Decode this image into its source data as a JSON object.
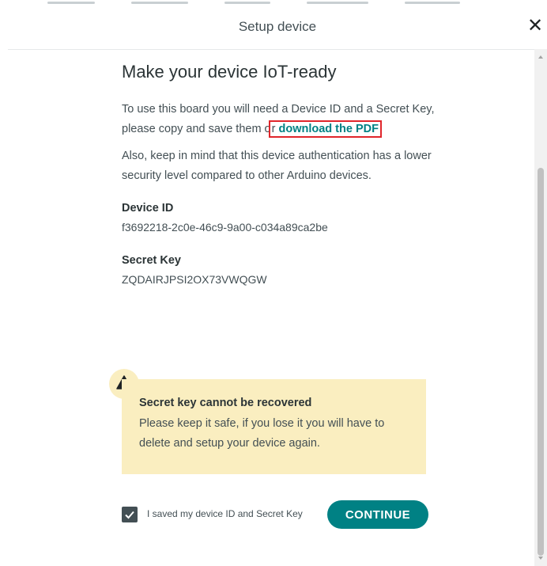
{
  "modal": {
    "title": "Setup device",
    "close_label": "✕"
  },
  "content": {
    "heading": "Make your device IoT-ready",
    "intro_text": "To use this board you will need a Device ID and a Secret Key, please copy and save them o",
    "intro_text_after": "r ",
    "download_link": "download the PDF",
    "intro_end": ".",
    "note": "Also, keep in mind that this device authentication has a lower security level compared to other Arduino devices.",
    "device_id_label": "Device ID",
    "device_id_value": "f3692218-2c0e-46c9-9a00-c034a89ca2be",
    "secret_key_label": "Secret Key",
    "secret_key_value": "ZQDAIRJPSI2OX73VWQGW"
  },
  "warning": {
    "icon": "warning-triangle-icon",
    "title": "Secret key cannot be recovered",
    "text": "Please keep it safe, if you lose it you will have to delete and setup your device again."
  },
  "footer": {
    "checkbox_checked": true,
    "checkbox_label": "I saved my device ID and Secret Key",
    "continue_label": "CONTINUE"
  },
  "colors": {
    "accent": "#008184",
    "warning_bg": "#faeec0",
    "highlight_box": "#e0262b"
  }
}
